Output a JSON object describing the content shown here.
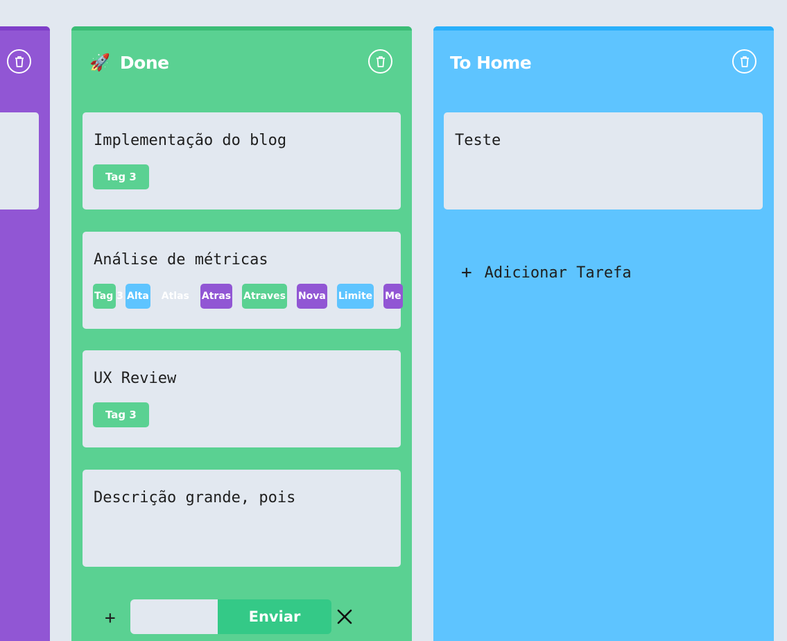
{
  "columns": [
    {
      "id": "purple",
      "title": "",
      "color": "#9156d4",
      "trash_icon": "trash-icon"
    },
    {
      "id": "done",
      "emoji": "🚀",
      "title": "Done",
      "color": "#5ad192",
      "trash_icon": "trash-icon",
      "cards": [
        {
          "title": "Implementação do blog",
          "tags": [
            {
              "label": "Tag 3",
              "color": "#5ad192"
            }
          ]
        },
        {
          "title": "Análise de métricas",
          "tags": [
            {
              "label": "Tag 3",
              "color": "#5ad192"
            },
            {
              "label": "Alta",
              "color": "#5ec4ff"
            },
            {
              "label": "Atlas",
              "color": "transparent"
            },
            {
              "label": "Atras",
              "color": "#9156d4"
            },
            {
              "label": "Atraves",
              "color": "#5ad192"
            },
            {
              "label": "Nova",
              "color": "#9156d4"
            },
            {
              "label": "Limite",
              "color": "#5ec4ff"
            },
            {
              "label": "Me",
              "color": "#9156d4"
            }
          ]
        },
        {
          "title": "UX Review",
          "tags": [
            {
              "label": "Tag 3",
              "color": "#5ad192"
            }
          ]
        },
        {
          "title": "Descrição grande, pois",
          "tags": []
        }
      ],
      "new_task": {
        "plus_label": "+",
        "input_value": "",
        "send_label": "Enviar",
        "close_label": "✕"
      }
    },
    {
      "id": "to-home",
      "title": "To Home",
      "color": "#5ec4ff",
      "trash_icon": "trash-icon",
      "cards": [
        {
          "title": "Teste",
          "tags": []
        }
      ],
      "add_label": "Adicionar Tarefa",
      "add_plus": "+"
    }
  ]
}
